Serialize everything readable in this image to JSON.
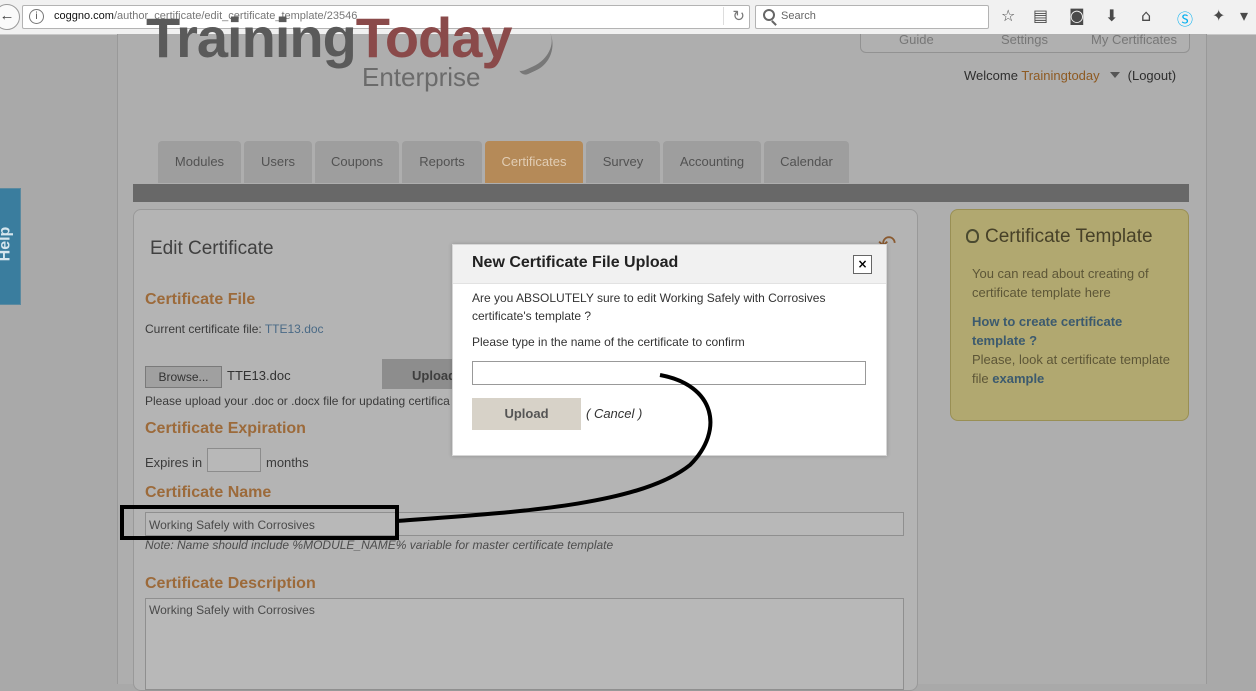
{
  "browser": {
    "url_domain": "coggno.com",
    "url_path": "/author_certificate/edit_certificate_template/23546",
    "search_placeholder": "Search"
  },
  "header": {
    "logo_main": "Training",
    "logo_accent": "Today",
    "logo_sub": "Enterprise",
    "top_links": [
      "Guide",
      "Settings",
      "My Certificates"
    ],
    "welcome": "Welcome",
    "username": "Trainingtoday",
    "logout": "(Logout)"
  },
  "tabs": [
    "Modules",
    "Users",
    "Coupons",
    "Reports",
    "Certificates",
    "Survey",
    "Accounting",
    "Calendar"
  ],
  "help_label": "Help",
  "edit": {
    "title": "Edit Certificate",
    "file_heading": "Certificate File",
    "current_file_label": "Current certificate file:",
    "current_file": "TTE13.doc",
    "browse_label": "Browse...",
    "chosen_file": "TTE13.doc",
    "upload_label": "Upload",
    "upload_hint": "Please upload your .doc or .docx file for updating certifica",
    "expiration_heading": "Certificate Expiration",
    "expires_in": "Expires in",
    "months": "months",
    "name_heading": "Certificate Name",
    "name_value": "Working Safely with Corrosives",
    "name_note": "Note: Name should include %MODULE_NAME% variable for master certificate template",
    "description_heading": "Certificate Description",
    "description_value": "Working Safely with Corrosives"
  },
  "sidebar": {
    "title": "Certificate Template",
    "intro": "You can read about creating of certificate template here",
    "link": "How to create certificate template ?",
    "look_text": "Please, look at certificate template file",
    "example": "example"
  },
  "modal": {
    "title": "New Certificate File Upload",
    "close": "×",
    "message": "Are you ABSOLUTELY sure to edit Working Safely with Corrosives certificate's template ?",
    "prompt": "Please type in the name of the certificate to confirm",
    "input_value": "",
    "upload_label": "Upload",
    "cancel_label": "( Cancel )"
  },
  "colors": {
    "accent_orange": "#e39a4b",
    "tab_active": "#b58a58",
    "sidebar_bg": "#b1a870",
    "help_tab": "#3a7d9e"
  }
}
